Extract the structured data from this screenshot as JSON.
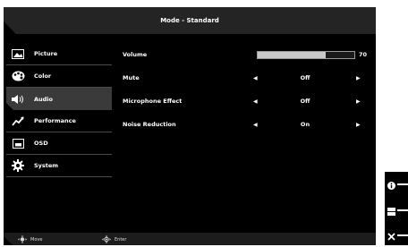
{
  "header": {
    "title": "Mode - Standard"
  },
  "sidebar": {
    "items": [
      {
        "label": "Picture",
        "icon": "picture-icon"
      },
      {
        "label": "Color",
        "icon": "color-palette-icon"
      },
      {
        "label": "Audio",
        "icon": "speaker-icon",
        "active": true
      },
      {
        "label": "Performance",
        "icon": "performance-icon"
      },
      {
        "label": "OSD",
        "icon": "osd-icon"
      },
      {
        "label": "System",
        "icon": "gear-icon"
      }
    ]
  },
  "settings": {
    "volume": {
      "label": "Volume",
      "value": "70",
      "level": 0.7
    },
    "mute": {
      "label": "Mute",
      "value": "Off"
    },
    "microphone": {
      "label": "Microphone Effect",
      "value": "Off"
    },
    "noise": {
      "label": "Noise Reduction",
      "value": "On"
    }
  },
  "footer": {
    "move_label": "Move",
    "enter_label": "Enter"
  },
  "keys": [
    {
      "icon": "info-icon"
    },
    {
      "icon": "input-source-icon"
    },
    {
      "icon": "close-icon"
    }
  ],
  "colors": {
    "background": "#000000",
    "header": "#242424",
    "active": "#3a3a3a",
    "text": "#ffffff"
  }
}
